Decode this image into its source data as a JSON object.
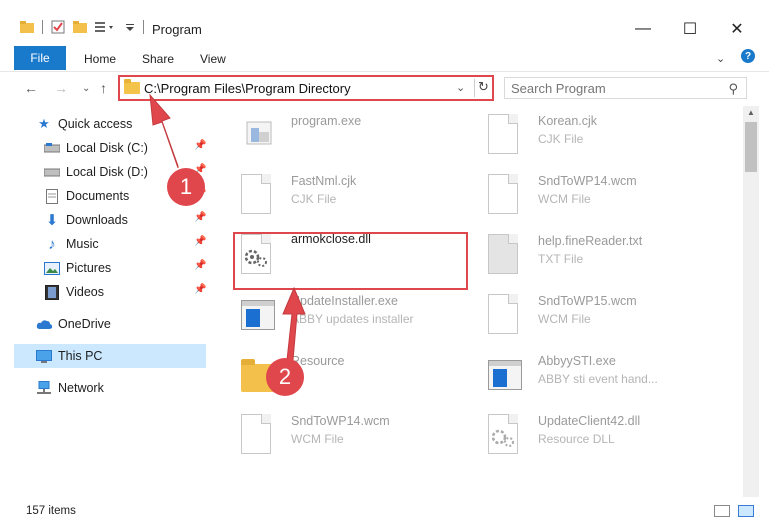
{
  "window": {
    "title": "Program",
    "minimize_glyph": "—",
    "maximize_glyph": "☐",
    "close_glyph": "✕"
  },
  "ribbon": {
    "file_label": "File",
    "tabs": [
      "Home",
      "Share",
      "View"
    ],
    "help_glyph": "?"
  },
  "address": {
    "path": "C:\\Program Files\\Program Directory"
  },
  "search": {
    "placeholder": "Search Program"
  },
  "sidebar": {
    "items": [
      {
        "label": "Quick access",
        "icon": "star-icon",
        "pinned": false
      },
      {
        "label": "Local Disk (C:)",
        "icon": "drive-icon",
        "pinned": true
      },
      {
        "label": "Local Disk (D:)",
        "icon": "drive-icon",
        "pinned": true
      },
      {
        "label": "Documents",
        "icon": "documents-icon",
        "pinned": true
      },
      {
        "label": "Downloads",
        "icon": "download-icon",
        "pinned": true
      },
      {
        "label": "Music",
        "icon": "music-icon",
        "pinned": true
      },
      {
        "label": "Pictures",
        "icon": "pictures-icon",
        "pinned": true
      },
      {
        "label": "Videos",
        "icon": "videos-icon",
        "pinned": true
      },
      {
        "label": "OneDrive",
        "icon": "cloud-icon",
        "pinned": false
      },
      {
        "label": "This PC",
        "icon": "computer-icon",
        "pinned": false,
        "selected": true
      },
      {
        "label": "Network",
        "icon": "network-icon",
        "pinned": false
      }
    ]
  },
  "files": [
    {
      "name": "program.exe",
      "type": "",
      "icon": "program-icon"
    },
    {
      "name": "Korean.cjk",
      "type": "CJK File",
      "icon": "document-icon"
    },
    {
      "name": "FastNml.cjk",
      "type": "CJK File",
      "icon": "document-icon"
    },
    {
      "name": "SndToWP14.wcm",
      "type": "WCM File",
      "icon": "document-icon"
    },
    {
      "name": "armokclose.dll",
      "type": "",
      "icon": "dll-gear-icon"
    },
    {
      "name": "help.fineReader.txt",
      "type": "TXT File",
      "icon": "text-document-icon"
    },
    {
      "name": "UpdateInstaller.exe",
      "type": "ABBY updates installer",
      "icon": "app-window-icon"
    },
    {
      "name": "SndToWP15.wcm",
      "type": "WCM File",
      "icon": "document-icon"
    },
    {
      "name": "Resource",
      "type": "",
      "icon": "folder-icon"
    },
    {
      "name": "AbbyySTI.exe",
      "type": "ABBY sti event hand...",
      "icon": "app-window-icon"
    },
    {
      "name": "SndToWP14.wcm",
      "type": "WCM File",
      "icon": "document-icon"
    },
    {
      "name": "UpdateClient42.dll",
      "type": "Resource DLL",
      "icon": "dll-gear-icon"
    }
  ],
  "status": {
    "item_count": "157 items"
  },
  "annotations": {
    "step1": "1",
    "step2": "2",
    "color": "#e0474c"
  }
}
